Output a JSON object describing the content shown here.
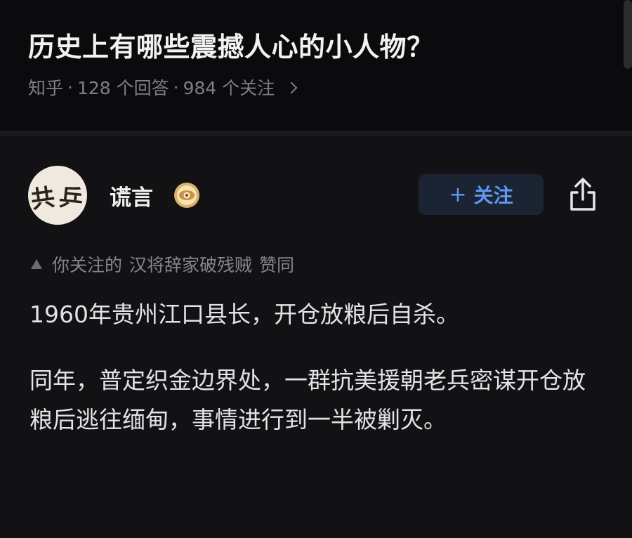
{
  "question": {
    "title": "历史上有哪些震撼人心的小人物？",
    "source": "知乎",
    "answers": "128 个回答",
    "followers": "984 个关注"
  },
  "answer": {
    "author": "谎言",
    "avatar_text": [
      "共",
      "乒"
    ],
    "follow_label": "关注",
    "endorse": {
      "prefix": "你关注的",
      "user": "汉将辞家破残贼",
      "action": "赞同"
    },
    "paragraphs": [
      "1960年贵州江口县长，开仓放粮后自杀。",
      "同年，普定织金边界处，一群抗美援朝老兵密谋开仓放粮后逃往缅甸，事情进行到一半被剿灭。"
    ]
  },
  "icons": {
    "badge": "eye-badge-icon",
    "share": "share-icon",
    "chevron": "chevron-right-icon",
    "endorse": "triangle-up-icon"
  },
  "colors": {
    "background": "#0b0b0d",
    "card": "#121214",
    "accent": "#5f97f3",
    "muted": "#7e7e86"
  }
}
